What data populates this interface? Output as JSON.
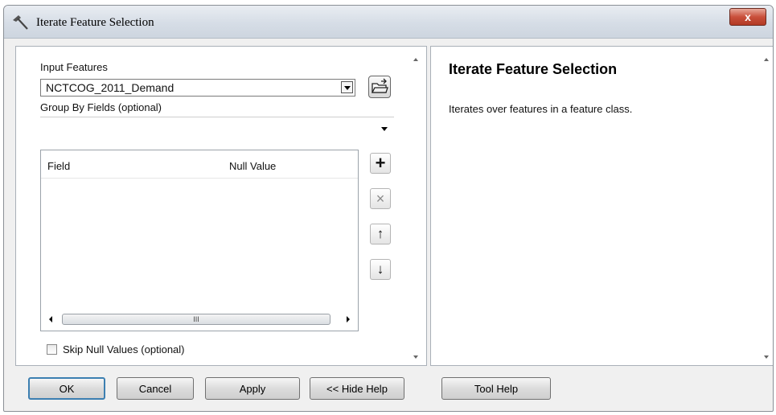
{
  "window": {
    "title": "Iterate Feature Selection",
    "close_label": "x"
  },
  "params": {
    "input_features_label": "Input Features",
    "input_features_value": "NCTCOG_2011_Demand",
    "group_by_label": "Group By Fields (optional)",
    "table": {
      "columns": [
        "Field",
        "Null Value"
      ],
      "scroll_thumb_glyph": "III"
    },
    "skip_null_label": "Skip Null Values (optional)",
    "skip_null_checked": false
  },
  "side_buttons": {
    "add": "+",
    "remove": "×",
    "up": "↑",
    "down": "↓"
  },
  "help": {
    "title": "Iterate Feature Selection",
    "description": "Iterates over features in a feature class."
  },
  "buttons": {
    "ok": "OK",
    "cancel": "Cancel",
    "apply": "Apply",
    "hide_help": "<< Hide Help",
    "tool_help": "Tool Help"
  },
  "colors": {
    "accent": "#3c7fb1",
    "close": "#c9503b"
  }
}
